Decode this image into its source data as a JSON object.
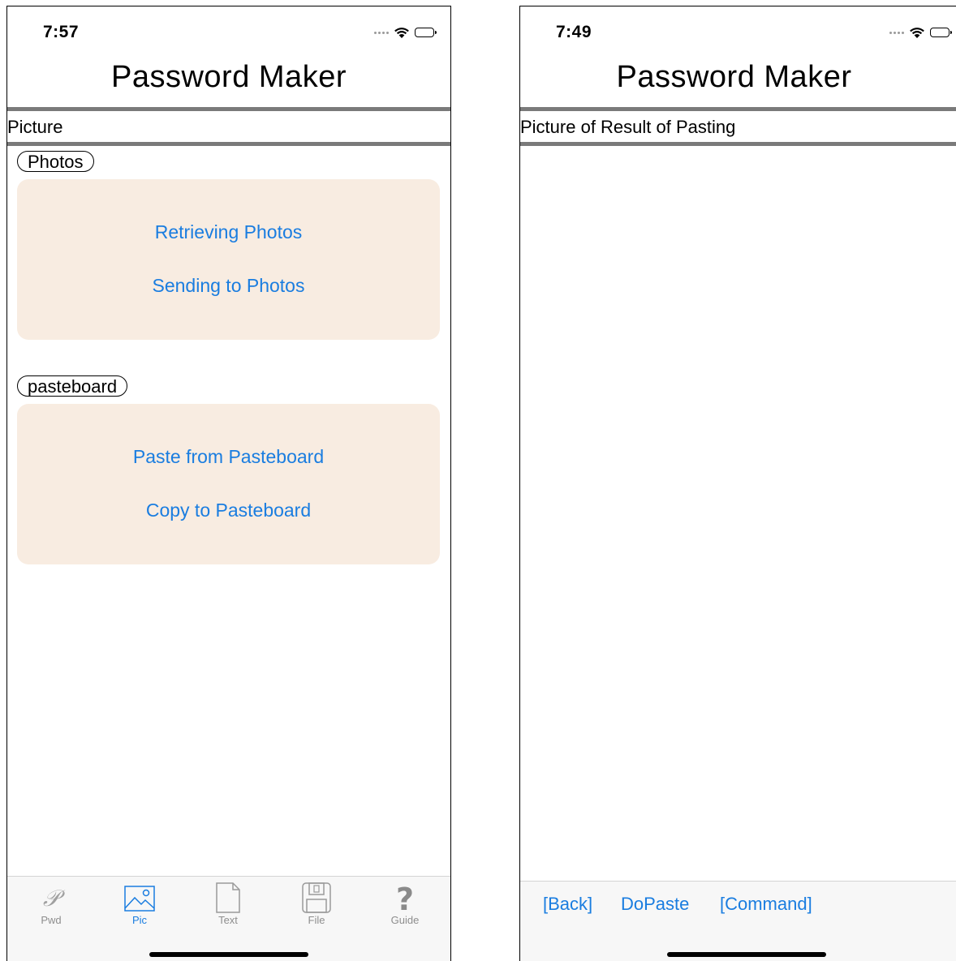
{
  "left": {
    "status_time": "7:57",
    "nav_title": "Password Maker",
    "section_label": "Picture",
    "photos_group": {
      "label": "Photos",
      "buttons": [
        "Retrieving Photos",
        "Sending to Photos"
      ]
    },
    "pasteboard_group": {
      "label": "pasteboard",
      "buttons": [
        "Paste from Pasteboard",
        "Copy to Pasteboard"
      ]
    },
    "tabs": [
      {
        "label": "Pwd",
        "icon": "script-p-icon",
        "active": false
      },
      {
        "label": "Pic",
        "icon": "picture-icon",
        "active": true
      },
      {
        "label": "Text",
        "icon": "document-icon",
        "active": false
      },
      {
        "label": "File",
        "icon": "floppy-disk-icon",
        "active": false
      },
      {
        "label": "Guide",
        "icon": "question-mark-icon",
        "active": false
      }
    ]
  },
  "right": {
    "status_time": "7:49",
    "nav_title": "Password Maker",
    "section_label": "Picture of Result of Pasting",
    "toolbar": {
      "back_label": "[Back]",
      "dopaste_label": "DoPaste",
      "command_label": "[Command]"
    }
  },
  "colors": {
    "accent": "#1a7de0",
    "card_background": "#f8ece1",
    "section_border": "#7a7a7a",
    "tab_inactive": "#8e8e8e"
  }
}
